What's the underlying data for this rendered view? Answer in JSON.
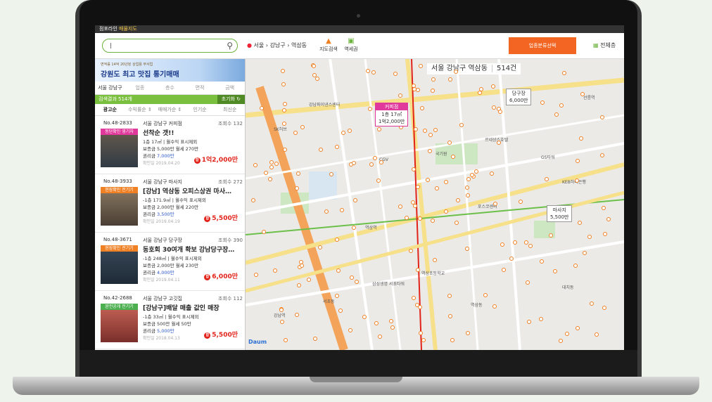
{
  "app": {
    "brand": "점포라인",
    "title": "매물지도"
  },
  "search": {
    "value": "|"
  },
  "breadcrumb": [
    "서울",
    "강남구",
    "역삼동"
  ],
  "tools": [
    {
      "label": "지도검색",
      "icon": "map-search-icon"
    },
    {
      "label": "역세권",
      "icon": "subway-icon"
    }
  ],
  "category_button": "업종분류선택",
  "fullscreen_button": "전체층",
  "banner": {
    "small": "면적률 14억 20년된 상업용 부서업",
    "big": "강원도 최고 맛집 통기매매"
  },
  "filters": [
    "서울 강남구",
    "업종",
    "층수",
    "면적",
    "금액"
  ],
  "result": {
    "label": "검색결과 514개",
    "refresh": "초기화"
  },
  "sort": [
    "광고순",
    "수익률순 ⇕",
    "매매가순 ⇕",
    "인기순",
    "최신순"
  ],
  "listings": [
    {
      "no": "No.48-2833",
      "loc": "서울 강남구 커피점",
      "views": "조회수 132",
      "tag": "동단확인 영기자",
      "tag_color": "#e0399b",
      "title": "선착순 갯!!",
      "l1": "1층 17㎡ | 월수익 표시제외",
      "l2": "보증금 5,000만  월세 270만",
      "l3a": "권리금 ",
      "l3b": "7,000만",
      "date": "확인일 2019.04.20",
      "price": "1억2,000만"
    },
    {
      "no": "No.48-3933",
      "loc": "서울 강남구 마사지",
      "views": "조회수 272",
      "tag": "현장확인 전기기",
      "tag_color": "#f08024",
      "title": "[강남] 역삼동 오피스상권 마사…",
      "l1": "-1층 171.9㎡ | 월수익 표시제외",
      "l2": "보증금 2,000만  월세 220만",
      "l3a": "권리금 ",
      "l3b": "3,500만",
      "date": "확인일 2019.04.19",
      "price": "5,500만"
    },
    {
      "no": "No.48-3671",
      "loc": "서울 강남구 당구장",
      "views": "조회수 390",
      "tag": "현장확인 전기기",
      "tag_color": "#f08024",
      "title": "동호회 30여개 확보 강남당구장…",
      "l1": "-1층 248㎡ | 월수익 표시제외",
      "l2": "보증금 2,000만  월세 230만",
      "l3a": "권리금 ",
      "l3b": "4,000만",
      "date": "확인일 2019.04.11",
      "price": "6,000만"
    },
    {
      "no": "No.42-2688",
      "loc": "서울 강남구 고깃집",
      "views": "조회수 112",
      "tag": "완전공개 전기기",
      "tag_color": "#4caf50",
      "title": "[강남구]배달 매출 값인 매장",
      "l1": "-1층 33㎡ | 월수익 표시제외",
      "l2": "보증금 500만  월세 50만",
      "l3a": "권리금 ",
      "l3b": "5,000만",
      "date": "확인일 2018.04.13",
      "price": "5,500만"
    }
  ],
  "map": {
    "title": "서울 강남구 역삼동",
    "count": "514건",
    "callouts": [
      {
        "head": "커피점",
        "l1": "1층 17㎡",
        "l2": "1억2,000만",
        "style": "pink"
      },
      {
        "head": "당구장",
        "l1": "6,000만",
        "l2": "",
        "style": "plain"
      },
      {
        "head": "마사지",
        "l1": "5,500만",
        "l2": "",
        "style": "plain"
      }
    ],
    "pois": [
      "역삼역",
      "강남역",
      "선릉역",
      "국기원",
      "르네상스호텔",
      "GS타워",
      "포스코센터",
      "삼성생명 서초타워",
      "서초동",
      "역삼동",
      "대치동",
      "강남파이낸스센터",
      "SK허브",
      "CGV",
      "KEB하나은행",
      "역삼초등학교"
    ],
    "logo": "Daum"
  }
}
